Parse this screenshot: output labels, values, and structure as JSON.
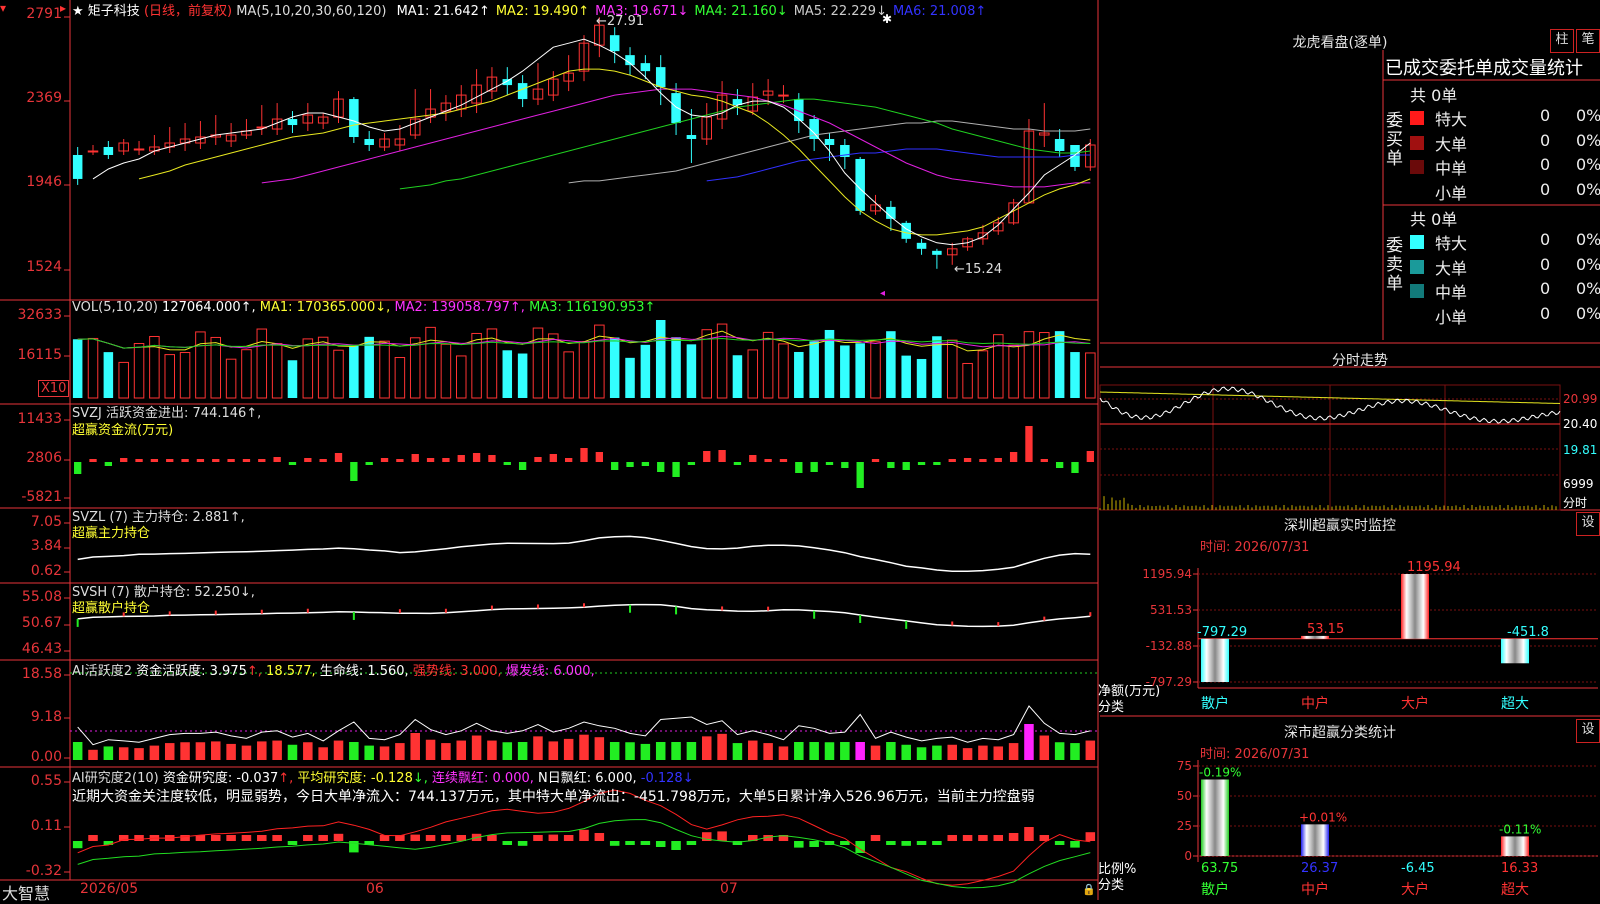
{
  "header": {
    "star": "★",
    "stock_name": "矩子科技",
    "period": "(日线，前复权)",
    "ma_label": "MA(5,10,20,30,60,120)",
    "ma": [
      {
        "label": "MA1:",
        "value": "21.642↑",
        "color": "#ffffff"
      },
      {
        "label": "MA2:",
        "value": "19.490↑",
        "color": "#ffff33"
      },
      {
        "label": "MA3:",
        "value": "19.671↓",
        "color": "#ff33ff"
      },
      {
        "label": "MA4:",
        "value": "21.160↓",
        "color": "#33ff33"
      },
      {
        "label": "MA5:",
        "value": "22.229↓",
        "color": "#cccccc"
      },
      {
        "label": "MA6:",
        "value": "21.008↑",
        "color": "#3333ff"
      }
    ]
  },
  "colors": {
    "up": "#ff3333",
    "down": "#33ffff",
    "green": "#22ee22",
    "axis": "#e8353a",
    "ma1": "#ffffff",
    "ma2": "#e8e820",
    "ma3": "#e020e0",
    "ma4": "#20d020",
    "ma5": "#b0b0b0",
    "ma6": "#3030ff"
  },
  "price_axis": {
    "labels": [
      "2791",
      "2369",
      "1946",
      "1524"
    ]
  },
  "price_annotations": {
    "high": "←27.91",
    "low": "←15.24"
  },
  "vol": {
    "header": "VOL(5,10,20)",
    "value": "127064.000↑,",
    "ma1": "MA1: 170365.000↓,",
    "ma2": "MA2: 139058.797↑,",
    "ma3": "MA3: 116190.953↑",
    "axis": [
      "32633",
      "16115"
    ],
    "unit": "X10"
  },
  "svzj": {
    "header": "SVZJ  活跃资金进出: 744.146↑,",
    "sub": "超赢资金流(万元)",
    "axis": [
      "11433",
      "2806",
      "-5821"
    ]
  },
  "svzl": {
    "header": "SVZL (7) 主力持仓: 2.881↑,",
    "sub": "超赢主力持仓",
    "axis": [
      "7.05",
      "3.84",
      "0.62"
    ]
  },
  "svsh": {
    "header": "SVSH (7) 散户持仓: 52.250↓,",
    "sub": "超赢散户持仓",
    "axis": [
      "55.08",
      "50.67",
      "46.43"
    ]
  },
  "ai_active": {
    "title": "AI活跃度2",
    "label": "资金活跃度: 3.975",
    "v2": "18.577,",
    "life": "生命线: 1.560,",
    "strong": "强势线: 3.000,",
    "burst": "爆发线: 6.000,",
    "axis": [
      "18.58",
      "9.18",
      "0.00"
    ]
  },
  "ai_research": {
    "title": "AI研究度2(10)",
    "label": "资金研究度: -0.037",
    "avg": "平均研究度: -0.128",
    "lh": "连续飘红: 0.000,",
    "nh": "N日飘红: 6.000,",
    "last": "-0.128",
    "note": "近期大资金关注度较低，明显弱势，今日大单净流入：744.137万元，其中特大单净流出：-451.798万元，大单5日累计净入526.96万元，当前主力控盘弱",
    "axis": [
      "0.55",
      "0.11",
      "-0.32"
    ]
  },
  "xaxis": {
    "brand": "大智慧",
    "dates": [
      "2026/05",
      "06",
      "07"
    ]
  },
  "right": {
    "dragon_title": "龙虎看盘(逐单)",
    "btn1": "柱",
    "btn2": "笔",
    "stat_title": "已成交委托单成交量统计",
    "buy_label": "委买单",
    "sell_label": "委卖单",
    "buy_total": "共 0单",
    "sell_total": "共 0单",
    "buy_rows": [
      {
        "name": "特大",
        "count": "0",
        "pct": "0%",
        "color": "#ff1a1a"
      },
      {
        "name": "大单",
        "count": "0",
        "pct": "0%",
        "color": "#a01010"
      },
      {
        "name": "中单",
        "count": "0",
        "pct": "0%",
        "color": "#6a0a0a"
      },
      {
        "name": "小单",
        "count": "0",
        "pct": "0%",
        "color": "#000000"
      }
    ],
    "sell_rows": [
      {
        "name": "特大",
        "count": "0",
        "pct": "0%",
        "color": "#33ffff"
      },
      {
        "name": "大单",
        "count": "0",
        "pct": "0%",
        "color": "#1a9a9a"
      },
      {
        "name": "中单",
        "count": "0",
        "pct": "0%",
        "color": "#127a7a"
      },
      {
        "name": "小单",
        "count": "0",
        "pct": "0%",
        "color": "#000000"
      }
    ],
    "intraday_title": "分时走势",
    "intraday_axis": [
      "20.99",
      "20.40",
      "19.81",
      "6999",
      "分时"
    ],
    "sz_title": "深圳超赢实时监控",
    "sz_btn": "设",
    "sz_time": "时间: 2026/07/31",
    "sz_axis": [
      "1195.94",
      "531.53",
      "-132.88",
      "-797.29"
    ],
    "sz_unit": "净额(万元)",
    "sz_cat_label": "分类",
    "sz_bars": [
      {
        "cat": "散户",
        "value": -797.29,
        "label": "-797.29",
        "label_color": "#33ffff"
      },
      {
        "cat": "中户",
        "value": 53.15,
        "label": "53.15",
        "label_color": "#ff3333"
      },
      {
        "cat": "大户",
        "value": 1195.94,
        "label": "1195.94",
        "label_color": "#ff3333"
      },
      {
        "cat": "超大",
        "value": -451.8,
        "label": "-451.8",
        "label_color": "#33ffff"
      }
    ],
    "cls_title": "深市超赢分类统计",
    "cls_btn": "设",
    "cls_time": "时间: 2026/07/31",
    "cls_axis": [
      "75",
      "50",
      "25",
      "0"
    ],
    "cls_unit": "比例%",
    "cls_cat_label": "分类",
    "cls_bars": [
      {
        "cat": "散户",
        "value": 63.75,
        "top": "-0.19%",
        "bottom": "63.75",
        "top_color": "#33ff33",
        "bottom_color": "#33ff33",
        "fill": "#22cc22"
      },
      {
        "cat": "中户",
        "value": 26.37,
        "top": "+0.01%",
        "bottom": "26.37",
        "top_color": "#ff3333",
        "bottom_color": "#3333ff",
        "fill": "#2222ee"
      },
      {
        "cat": "大户",
        "value": 0,
        "top": "",
        "bottom": "-6.45",
        "top_color": "#ff3333",
        "bottom_color": "#33ffff",
        "fill": "#ff2222"
      },
      {
        "cat": "超大",
        "value": 16.33,
        "top": "-0.11%",
        "bottom": "16.33",
        "top_color": "#33ff33",
        "bottom_color": "#ff3333",
        "fill": "#ff2222"
      }
    ]
  },
  "chart_data": {
    "type": "candlestick",
    "price_axis": {
      "labels": [
        "2791",
        "2369",
        "1946",
        "1524"
      ]
    },
    "high": 27.91,
    "low": 15.24,
    "candles": [
      [
        21,
        19.8,
        19.5,
        21.4
      ],
      [
        21.2,
        21.2,
        21,
        21.5
      ],
      [
        21.4,
        21,
        20.8,
        21.7
      ],
      [
        21.2,
        21.6,
        21,
        21.8
      ],
      [
        21.3,
        21.3,
        21,
        21.7
      ],
      [
        21.2,
        21.4,
        21,
        22
      ],
      [
        21.4,
        21.6,
        21.1,
        22.4
      ],
      [
        21.6,
        21.8,
        21.2,
        22.6
      ],
      [
        21.6,
        21.9,
        21.3,
        22.7
      ],
      [
        21.9,
        22,
        21.5,
        23
      ],
      [
        21.7,
        22,
        21.4,
        22.6
      ],
      [
        22,
        22.2,
        21.8,
        22.8
      ],
      [
        22.4,
        22.4,
        22,
        23.5
      ],
      [
        22.3,
        22.8,
        22,
        23.6
      ],
      [
        22.8,
        22.5,
        22.1,
        23.2
      ],
      [
        22.6,
        23,
        22.2,
        23.6
      ],
      [
        22.6,
        22.9,
        22.3,
        23.1
      ],
      [
        22.9,
        23.8,
        22.6,
        24.2
      ],
      [
        23.8,
        21.9,
        21.6,
        23.9
      ],
      [
        21.8,
        21.5,
        21.2,
        22.2
      ],
      [
        21.4,
        21.8,
        21.2,
        22.1
      ],
      [
        21.5,
        21.8,
        21.2,
        22.5
      ],
      [
        22,
        22.8,
        21.8,
        24.3
      ],
      [
        22.9,
        23.3,
        22.6,
        24.3
      ],
      [
        23.2,
        23.6,
        22.7,
        24
      ],
      [
        23.3,
        24,
        22.9,
        24.5
      ],
      [
        23.6,
        24.5,
        23.1,
        25.3
      ],
      [
        24.2,
        24.9,
        23.8,
        25.4
      ],
      [
        24.8,
        24.5,
        24,
        25.4
      ],
      [
        24.6,
        23.8,
        23.4,
        25
      ],
      [
        23.8,
        24.3,
        23.5,
        25.6
      ],
      [
        24,
        24.8,
        23.7,
        25.2
      ],
      [
        24.7,
        25.1,
        24.2,
        26
      ],
      [
        25.2,
        26.6,
        24.7,
        27
      ],
      [
        26.5,
        27.5,
        25.9,
        27.9
      ],
      [
        27,
        26.2,
        25.6,
        27.4
      ],
      [
        26,
        25.5,
        25,
        26.4
      ],
      [
        25.6,
        25.2,
        24.8,
        26
      ],
      [
        25.4,
        24.4,
        23.5,
        26
      ],
      [
        24.1,
        22.6,
        22,
        24.6
      ],
      [
        22,
        21.8,
        20.6,
        23.3
      ],
      [
        21.8,
        22.9,
        21.5,
        23.6
      ],
      [
        22.8,
        24,
        22.3,
        24.7
      ],
      [
        23.8,
        23.5,
        23,
        24.3
      ],
      [
        23.2,
        23.9,
        23,
        24.6
      ],
      [
        24,
        24.2,
        23.5,
        24.8
      ],
      [
        24,
        24,
        23.6,
        24.5
      ],
      [
        23.8,
        22.7,
        22.1,
        24.1
      ],
      [
        22.8,
        21.8,
        21.2,
        23
      ],
      [
        21.8,
        21.5,
        20.7,
        22.1
      ],
      [
        21.5,
        20.9,
        20.3,
        21.8
      ],
      [
        20.8,
        18.2,
        18,
        20.9
      ],
      [
        18.2,
        18.5,
        18,
        19
      ],
      [
        18.4,
        17.8,
        17.2,
        18.7
      ],
      [
        17.6,
        16.8,
        16.6,
        17.7
      ],
      [
        16.6,
        16.3,
        16,
        16.8
      ],
      [
        16.2,
        16,
        15.3,
        16.3
      ],
      [
        16,
        16.3,
        15.5,
        16.6
      ],
      [
        16.4,
        16.8,
        16.2,
        16.9
      ],
      [
        16.8,
        17.1,
        16.5,
        17.5
      ],
      [
        17.2,
        17.6,
        17,
        17.9
      ],
      [
        17.6,
        18.6,
        17.5,
        18.8
      ],
      [
        18.6,
        22.2,
        18.6,
        22.8
      ],
      [
        22,
        22.1,
        21.4,
        23.6
      ],
      [
        21.8,
        21.2,
        20.9,
        22.3
      ],
      [
        21.5,
        20.4,
        20.2,
        21.5
      ],
      [
        20.4,
        21.5,
        20.2,
        21.8
      ]
    ],
    "ma1": [
      19.8,
      20.3,
      20.6,
      20.8,
      21.2,
      21.4,
      21.6,
      21.8,
      22,
      22.1,
      22.2,
      22.3,
      22.6,
      22.9,
      23.1,
      23.1,
      22.9,
      22.7,
      22.4,
      22.2,
      22.3,
      22.6,
      22.9,
      23.2,
      23.5,
      23.9,
      24.3,
      24.7,
      25.2,
      25.8,
      26.4,
      26.6,
      26.8,
      26.5,
      26.1,
      25.6,
      24.9,
      24.1,
      23.4,
      23,
      22.9,
      23.1,
      23.5,
      23.7,
      23.7,
      23.4,
      22.8,
      22.1,
      21.2,
      20.1,
      19.3,
      18.6,
      17.9,
      17.3,
      16.9,
      16.6,
      16.5,
      16.6,
      16.9,
      17.5,
      18.3,
      19.1,
      20,
      20.5,
      21,
      21.6
    ],
    "ma2": [
      19.8,
      20,
      20.2,
      20.5,
      20.7,
      20.9,
      21.1,
      21.3,
      21.5,
      21.7,
      21.9,
      22,
      22.1,
      22.3,
      22.5,
      22.6,
      22.7,
      22.8,
      22.9,
      23,
      23.1,
      23.3,
      23.5,
      23.7,
      24,
      24.3,
      24.6,
      24.9,
      25.2,
      25.3,
      25.3,
      25.2,
      25,
      24.7,
      24.4,
      24.2,
      24,
      23.9,
      23.7,
      23.4,
      23.1,
      22.6,
      22,
      21.3,
      20.5,
      19.7,
      18.9,
      18.2,
      17.7,
      17.3,
      17.1,
      17,
      17,
      17.1,
      17.2,
      17.4,
      17.8,
      18.2,
      18.6,
      19,
      19.3,
      19.5,
      19.8
    ],
    "ma3": [
      19.6,
      19.7,
      19.8,
      20,
      20.2,
      20.4,
      20.6,
      20.8,
      21,
      21.2,
      21.4,
      21.6,
      21.8,
      22,
      22.2,
      22.4,
      22.6,
      22.8,
      23,
      23.2,
      23.4,
      23.6,
      23.8,
      24,
      24.1,
      24.2,
      24.3,
      24.3,
      24.3,
      24.2,
      24.1,
      24,
      23.9,
      23.7,
      23.5,
      23.2,
      22.9,
      22.6,
      22.2,
      21.8,
      21.4,
      21,
      20.6,
      20.3,
      20,
      19.8,
      19.7,
      19.6,
      19.5,
      19.4,
      19.4,
      19.4,
      19.5,
      19.6,
      19.6
    ],
    "ma4": [
      19.3,
      19.4,
      19.5,
      19.7,
      19.8,
      20,
      20.2,
      20.4,
      20.6,
      20.8,
      21,
      21.2,
      21.4,
      21.6,
      21.8,
      22,
      22.2,
      22.4,
      22.6,
      22.8,
      23,
      23.2,
      23.4,
      23.5,
      23.6,
      23.7,
      23.8,
      23.8,
      23.7,
      23.6,
      23.5,
      23.4,
      23.2,
      23,
      22.8,
      22.6,
      22.3,
      22.1,
      21.9,
      21.7,
      21.5,
      21.3,
      21.2,
      21.1,
      21.1,
      21.2
    ],
    "ma5": [
      19.6,
      19.7,
      19.7,
      19.8,
      19.9,
      20,
      20.1,
      20.2,
      20.4,
      20.6,
      20.8,
      21,
      21.2,
      21.4,
      21.6,
      21.8,
      22,
      22.1,
      22.2,
      22.3,
      22.4,
      22.5,
      22.6,
      22.6,
      22.7,
      22.7,
      22.6,
      22.5,
      22.4,
      22.3,
      22.3,
      22.2,
      22.2,
      22.2,
      22.3
    ],
    "ma6": [
      19.7,
      19.8,
      19.9,
      20.1,
      20.3,
      20.5,
      20.7,
      20.8,
      20.9,
      21,
      21.1,
      21.1,
      21.2,
      21.3,
      21.3,
      21.3,
      21.2,
      21.1,
      21,
      20.9,
      20.9,
      20.9,
      20.9,
      20.9,
      21,
      21
    ]
  }
}
